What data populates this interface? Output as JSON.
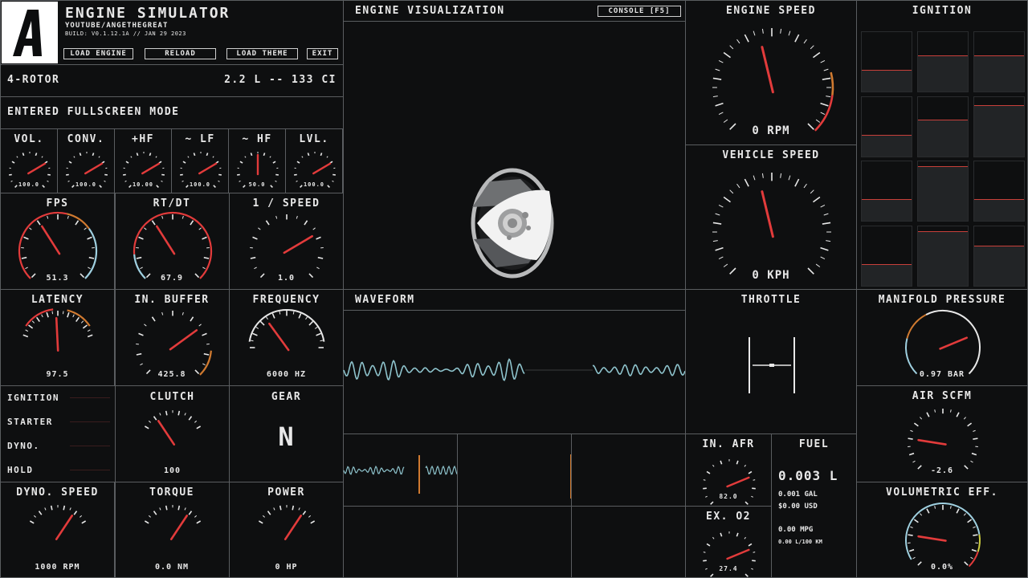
{
  "header": {
    "title": "ENGINE SIMULATOR",
    "subtitle": "YOUTUBE/ANGETHEGREAT",
    "build": "BUILD: V0.1.12.1A // JAN 29 2023",
    "buttons": [
      "LOAD ENGINE",
      "RELOAD",
      "LOAD THEME",
      "EXIT"
    ]
  },
  "engine": {
    "name": "4-ROTOR",
    "displacement": "2.2 L -- 133 CI"
  },
  "status": "ENTERED FULLSCREEN MODE",
  "audio_gauges": [
    {
      "label": "VOL.",
      "value": "100.0"
    },
    {
      "label": "CONV.",
      "value": "100.0"
    },
    {
      "label": "+HF",
      "value": "10.00"
    },
    {
      "label": "~ LF",
      "value": "100.0"
    },
    {
      "label": "~ HF",
      "value": "50.0"
    },
    {
      "label": "LVL.",
      "value": "100.0"
    }
  ],
  "perf_gauges": [
    {
      "label": "FPS",
      "value": "51.3"
    },
    {
      "label": "RT/DT",
      "value": "67.9"
    },
    {
      "label": "1 / SPEED",
      "value": "1.0"
    },
    {
      "label": "LATENCY",
      "value": "97.5"
    },
    {
      "label": "IN. BUFFER",
      "value": "425.8"
    },
    {
      "label": "FREQUENCY",
      "value": "6000 HZ"
    }
  ],
  "indicators": [
    "IGNITION",
    "STARTER",
    "DYNO.",
    "HOLD"
  ],
  "clutch": {
    "label": "CLUTCH",
    "value": "100"
  },
  "gear": {
    "label": "GEAR",
    "value": "N"
  },
  "dyno": [
    {
      "label": "DYNO. SPEED",
      "value": "1000 RPM"
    },
    {
      "label": "TORQUE",
      "value": "0.0 NM"
    },
    {
      "label": "POWER",
      "value": "0 HP"
    }
  ],
  "visualization": {
    "title": "ENGINE VISUALIZATION",
    "console": "CONSOLE [F5]"
  },
  "waveform": {
    "title": "WAVEFORM"
  },
  "engine_speed": {
    "label": "ENGINE SPEED",
    "value": "0 RPM"
  },
  "vehicle_speed": {
    "label": "VEHICLE SPEED",
    "value": "0 KPH"
  },
  "throttle": {
    "label": "THROTTLE"
  },
  "ignition": {
    "label": "IGNITION",
    "levels": [
      0.35,
      0.6,
      0.6,
      0.35,
      0.6,
      0.85,
      0.35,
      0.9,
      0.35,
      0.35,
      0.9,
      0.65
    ]
  },
  "manifold": {
    "label": "MANIFOLD PRESSURE",
    "value": "0.97 BAR"
  },
  "air": {
    "label": "AIR SCFM",
    "value": "-2.6"
  },
  "volumetric": {
    "label": "VOLUMETRIC EFF.",
    "value": "0.0%"
  },
  "in_afr": {
    "label": "IN. AFR",
    "value": "82.0"
  },
  "ex_o2": {
    "label": "EX. O2",
    "value": "27.4"
  },
  "fuel": {
    "label": "FUEL",
    "value": "0.003 L",
    "gal": "0.001 GAL",
    "usd": "$0.00 USD",
    "mpg": "0.00 MPG",
    "l100": "0.00 L/100 KM"
  }
}
